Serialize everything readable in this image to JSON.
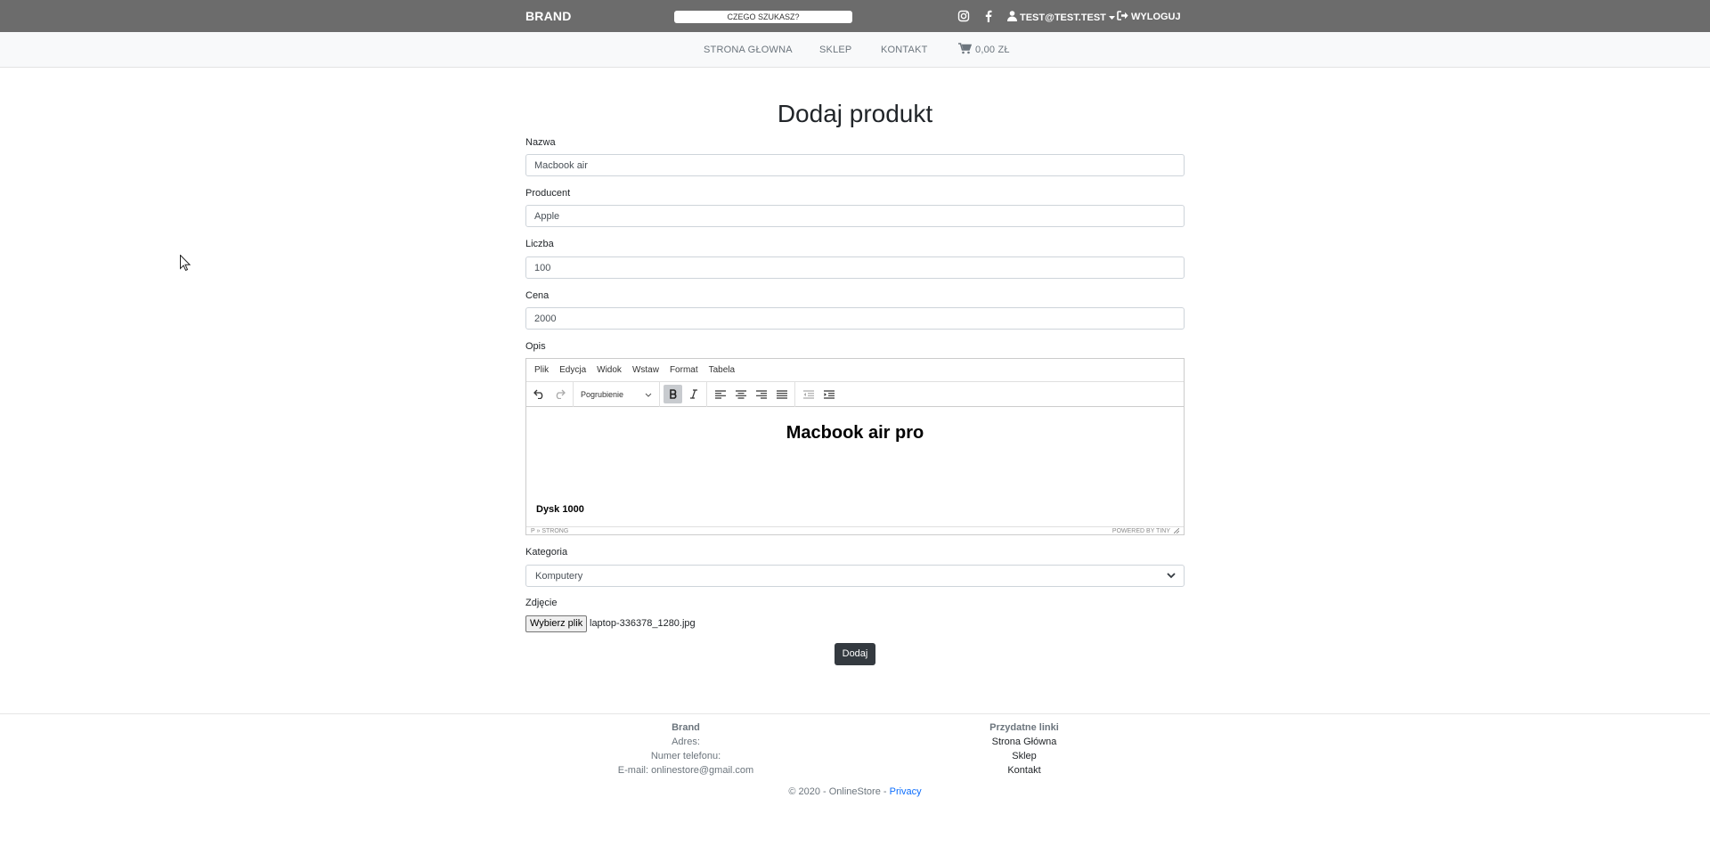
{
  "header": {
    "brand": "BRAND",
    "search_placeholder": "CZEGO SZUKASZ?",
    "user_label": "TEST@TEST.TEST",
    "logout_label": "WYLOGUJ"
  },
  "nav": {
    "items": [
      "STRONA GŁOWNA",
      "SKLEP",
      "KONTAKT"
    ],
    "cart_label": "0,00 ZŁ"
  },
  "form": {
    "title": "Dodaj produkt",
    "fields": [
      {
        "label": "Nazwa",
        "value": "Macbook air"
      },
      {
        "label": "Producent",
        "value": "Apple"
      },
      {
        "label": "Liczba",
        "value": "100"
      },
      {
        "label": "Cena",
        "value": "2000"
      }
    ],
    "description_label": "Opis",
    "editor": {
      "menu": [
        "Plik",
        "Edycja",
        "Widok",
        "Wstaw",
        "Format",
        "Tabela"
      ],
      "block_format": "Pogrubienie",
      "heading": "Macbook air pro",
      "paragraph": "Dysk 1000",
      "path": "P » STRONG",
      "powered_by": "POWERED BY TINY"
    },
    "category_label": "Kategoria",
    "category_value": "Komputery",
    "image_label": "Zdjęcie",
    "file_button": "Wybierz plik",
    "file_name": "laptop-336378_1280.jpg",
    "submit_label": "Dodaj"
  },
  "footer": {
    "col1": {
      "title": "Brand",
      "lines": [
        "Adres:",
        "Numer telefonu:",
        "E-mail: onlinestore@gmail.com"
      ]
    },
    "col2": {
      "title": "Przydatne linki",
      "links": [
        "Strona Główna",
        "Sklep",
        "Kontakt"
      ]
    },
    "copyright": "© 2020 - OnlineStore - ",
    "privacy": "Privacy"
  }
}
